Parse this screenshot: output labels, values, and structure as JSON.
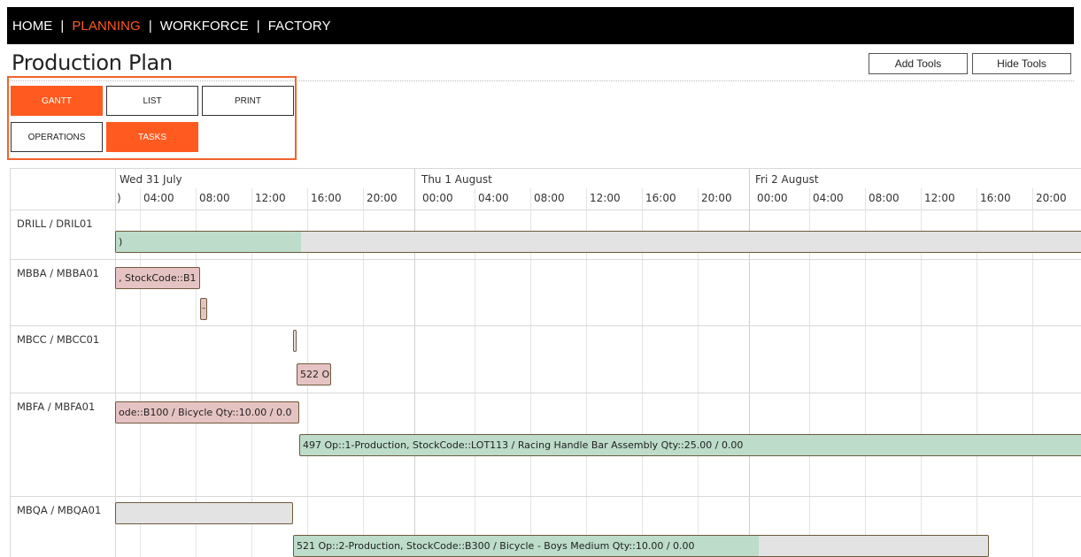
{
  "nav": {
    "items": [
      {
        "label": "HOME",
        "active": false
      },
      {
        "label": "PLANNING",
        "active": true
      },
      {
        "label": "WORKFORCE",
        "active": false
      },
      {
        "label": "FACTORY",
        "active": false
      }
    ],
    "separator": "|"
  },
  "page": {
    "title": "Production Plan",
    "add_tools": "Add Tools",
    "hide_tools": "Hide Tools"
  },
  "views": {
    "gantt": "GANTT",
    "list": "LIST",
    "print": "PRINT",
    "operations": "OPERATIONS",
    "tasks": "TASKS",
    "active": [
      "gantt",
      "tasks"
    ]
  },
  "colors": {
    "accent": "#ff5a1f",
    "highlight_border": "#f2632b",
    "bar_pink": "#e6c3c3",
    "bar_green": "#bddcc9",
    "bar_grey": "#e3e3e3"
  },
  "timeline": {
    "days": [
      "Wed 31 July",
      "Thu 1 August",
      "Fri 2 August"
    ],
    "first_hour_fragment": ")",
    "hours": [
      "04:00",
      "08:00",
      "12:00",
      "16:00",
      "20:00"
    ],
    "midnight": "00:00"
  },
  "rows": [
    {
      "resource": "DRILL / DRIL01",
      "bars": [
        {
          "text": ")",
          "color": "grey",
          "progress": 0.19
        }
      ]
    },
    {
      "resource": "MBBA / MBBA01",
      "bars": [
        {
          "text": ", StockCode::B1",
          "color": "pink"
        },
        {
          "text": "–",
          "color": "pink"
        }
      ]
    },
    {
      "resource": "MBCC / MBCC01",
      "bars": [
        {
          "text": "",
          "color": "grey"
        },
        {
          "text": "522 O",
          "color": "pink"
        }
      ]
    },
    {
      "resource": "MBFA / MBFA01",
      "bars": [
        {
          "text": "ode::B100 / Bicycle Qty::10.00 / 0.0",
          "color": "pink"
        },
        {
          "text": "497 Op::1-Production, StockCode::LOT113 / Racing Handle Bar Assembly Qty::25.00 / 0.00",
          "color": "green"
        }
      ]
    },
    {
      "resource": "MBQA / MBQA01",
      "bars": [
        {
          "text": "",
          "color": "grey"
        },
        {
          "text": "521 Op::2-Production, StockCode::B300 / Bicycle - Boys Medium Qty::10.00 / 0.00",
          "color": "grey",
          "progress": 0.67
        }
      ]
    }
  ]
}
